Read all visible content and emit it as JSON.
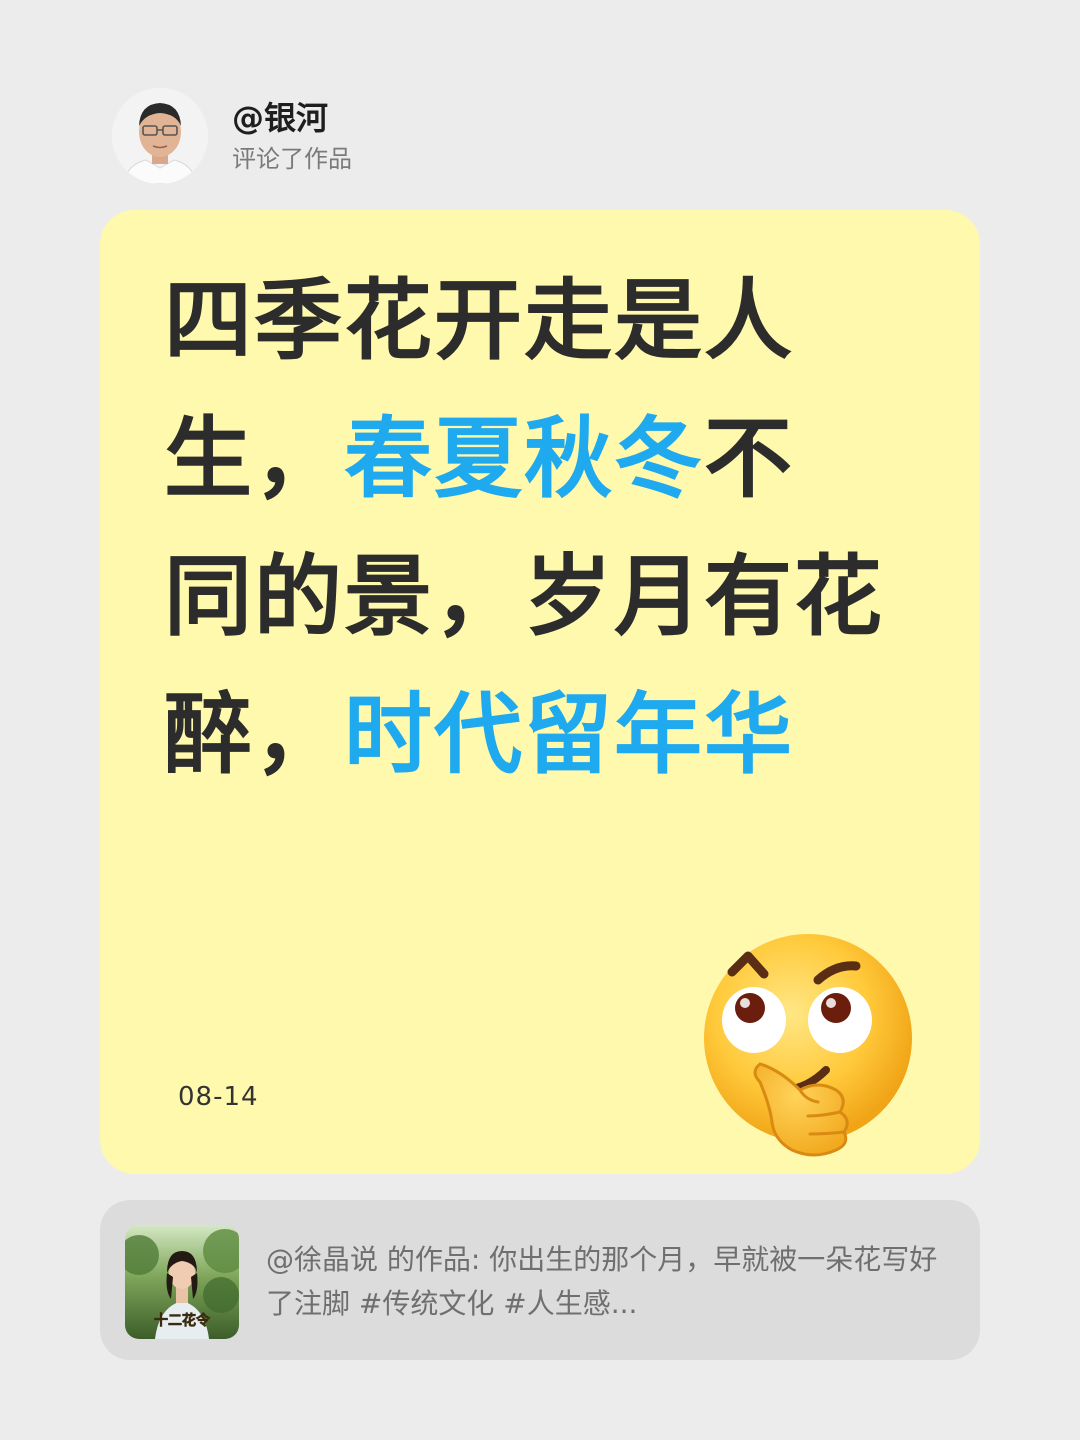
{
  "header": {
    "username": "@银河",
    "action": "评论了作品"
  },
  "comment": {
    "segments": [
      {
        "text": "四季花开走是人生，",
        "highlight": false
      },
      {
        "text": "春夏秋冬",
        "highlight": true
      },
      {
        "text": "不同的景，岁月有花醉，",
        "highlight": false
      },
      {
        "text": "时代留年华",
        "highlight": true
      }
    ],
    "date": "08-14",
    "emoji": "thinking-face-icon"
  },
  "work": {
    "description": "@徐晶说 的作品: 你出生的那个月，早就被一朵花写好了注脚 #传统文化 #人生感...",
    "thumbnail_caption": "十二花令"
  },
  "colors": {
    "page_background": "#ececec",
    "card_background": "#fff9ad",
    "highlight_text": "#1fa9ee",
    "main_text": "#2c2c2c",
    "work_card_background": "#dcdcdc",
    "secondary_text": "#7a7a7a"
  }
}
